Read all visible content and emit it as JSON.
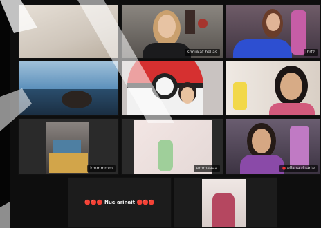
{
  "gallery": {
    "participants": [
      {
        "label": ""
      },
      {
        "label": "shoukat bellas"
      },
      {
        "label": "hrfz"
      },
      {
        "label": ""
      },
      {
        "label": ""
      },
      {
        "label": ""
      },
      {
        "label": "kmmmmm"
      },
      {
        "label": "emmaaaa"
      },
      {
        "label": "ellana duarte"
      },
      {
        "label": ""
      },
      {
        "label": ""
      }
    ],
    "name_card": {
      "prefix": "🔴🔴🔴",
      "text": "Nue arinait",
      "suffix": "🔴🔴🔴"
    }
  },
  "colors": {
    "background": "#0e0e0e",
    "tile_border": "#111111",
    "mute_red": "#e33333"
  }
}
